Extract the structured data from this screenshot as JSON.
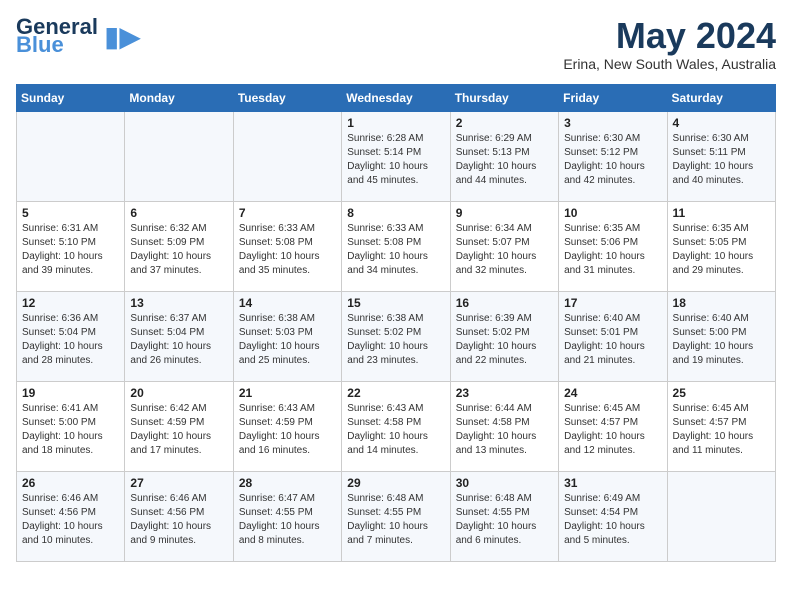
{
  "logo": {
    "line1": "General",
    "line2": "Blue",
    "icon": "▲"
  },
  "title": {
    "month_year": "May 2024",
    "location": "Erina, New South Wales, Australia"
  },
  "days_of_week": [
    "Sunday",
    "Monday",
    "Tuesday",
    "Wednesday",
    "Thursday",
    "Friday",
    "Saturday"
  ],
  "weeks": [
    [
      {
        "day": "",
        "info": ""
      },
      {
        "day": "",
        "info": ""
      },
      {
        "day": "",
        "info": ""
      },
      {
        "day": "1",
        "info": "Sunrise: 6:28 AM\nSunset: 5:14 PM\nDaylight: 10 hours\nand 45 minutes."
      },
      {
        "day": "2",
        "info": "Sunrise: 6:29 AM\nSunset: 5:13 PM\nDaylight: 10 hours\nand 44 minutes."
      },
      {
        "day": "3",
        "info": "Sunrise: 6:30 AM\nSunset: 5:12 PM\nDaylight: 10 hours\nand 42 minutes."
      },
      {
        "day": "4",
        "info": "Sunrise: 6:30 AM\nSunset: 5:11 PM\nDaylight: 10 hours\nand 40 minutes."
      }
    ],
    [
      {
        "day": "5",
        "info": "Sunrise: 6:31 AM\nSunset: 5:10 PM\nDaylight: 10 hours\nand 39 minutes."
      },
      {
        "day": "6",
        "info": "Sunrise: 6:32 AM\nSunset: 5:09 PM\nDaylight: 10 hours\nand 37 minutes."
      },
      {
        "day": "7",
        "info": "Sunrise: 6:33 AM\nSunset: 5:08 PM\nDaylight: 10 hours\nand 35 minutes."
      },
      {
        "day": "8",
        "info": "Sunrise: 6:33 AM\nSunset: 5:08 PM\nDaylight: 10 hours\nand 34 minutes."
      },
      {
        "day": "9",
        "info": "Sunrise: 6:34 AM\nSunset: 5:07 PM\nDaylight: 10 hours\nand 32 minutes."
      },
      {
        "day": "10",
        "info": "Sunrise: 6:35 AM\nSunset: 5:06 PM\nDaylight: 10 hours\nand 31 minutes."
      },
      {
        "day": "11",
        "info": "Sunrise: 6:35 AM\nSunset: 5:05 PM\nDaylight: 10 hours\nand 29 minutes."
      }
    ],
    [
      {
        "day": "12",
        "info": "Sunrise: 6:36 AM\nSunset: 5:04 PM\nDaylight: 10 hours\nand 28 minutes."
      },
      {
        "day": "13",
        "info": "Sunrise: 6:37 AM\nSunset: 5:04 PM\nDaylight: 10 hours\nand 26 minutes."
      },
      {
        "day": "14",
        "info": "Sunrise: 6:38 AM\nSunset: 5:03 PM\nDaylight: 10 hours\nand 25 minutes."
      },
      {
        "day": "15",
        "info": "Sunrise: 6:38 AM\nSunset: 5:02 PM\nDaylight: 10 hours\nand 23 minutes."
      },
      {
        "day": "16",
        "info": "Sunrise: 6:39 AM\nSunset: 5:02 PM\nDaylight: 10 hours\nand 22 minutes."
      },
      {
        "day": "17",
        "info": "Sunrise: 6:40 AM\nSunset: 5:01 PM\nDaylight: 10 hours\nand 21 minutes."
      },
      {
        "day": "18",
        "info": "Sunrise: 6:40 AM\nSunset: 5:00 PM\nDaylight: 10 hours\nand 19 minutes."
      }
    ],
    [
      {
        "day": "19",
        "info": "Sunrise: 6:41 AM\nSunset: 5:00 PM\nDaylight: 10 hours\nand 18 minutes."
      },
      {
        "day": "20",
        "info": "Sunrise: 6:42 AM\nSunset: 4:59 PM\nDaylight: 10 hours\nand 17 minutes."
      },
      {
        "day": "21",
        "info": "Sunrise: 6:43 AM\nSunset: 4:59 PM\nDaylight: 10 hours\nand 16 minutes."
      },
      {
        "day": "22",
        "info": "Sunrise: 6:43 AM\nSunset: 4:58 PM\nDaylight: 10 hours\nand 14 minutes."
      },
      {
        "day": "23",
        "info": "Sunrise: 6:44 AM\nSunset: 4:58 PM\nDaylight: 10 hours\nand 13 minutes."
      },
      {
        "day": "24",
        "info": "Sunrise: 6:45 AM\nSunset: 4:57 PM\nDaylight: 10 hours\nand 12 minutes."
      },
      {
        "day": "25",
        "info": "Sunrise: 6:45 AM\nSunset: 4:57 PM\nDaylight: 10 hours\nand 11 minutes."
      }
    ],
    [
      {
        "day": "26",
        "info": "Sunrise: 6:46 AM\nSunset: 4:56 PM\nDaylight: 10 hours\nand 10 minutes."
      },
      {
        "day": "27",
        "info": "Sunrise: 6:46 AM\nSunset: 4:56 PM\nDaylight: 10 hours\nand 9 minutes."
      },
      {
        "day": "28",
        "info": "Sunrise: 6:47 AM\nSunset: 4:55 PM\nDaylight: 10 hours\nand 8 minutes."
      },
      {
        "day": "29",
        "info": "Sunrise: 6:48 AM\nSunset: 4:55 PM\nDaylight: 10 hours\nand 7 minutes."
      },
      {
        "day": "30",
        "info": "Sunrise: 6:48 AM\nSunset: 4:55 PM\nDaylight: 10 hours\nand 6 minutes."
      },
      {
        "day": "31",
        "info": "Sunrise: 6:49 AM\nSunset: 4:54 PM\nDaylight: 10 hours\nand 5 minutes."
      },
      {
        "day": "",
        "info": ""
      }
    ]
  ]
}
